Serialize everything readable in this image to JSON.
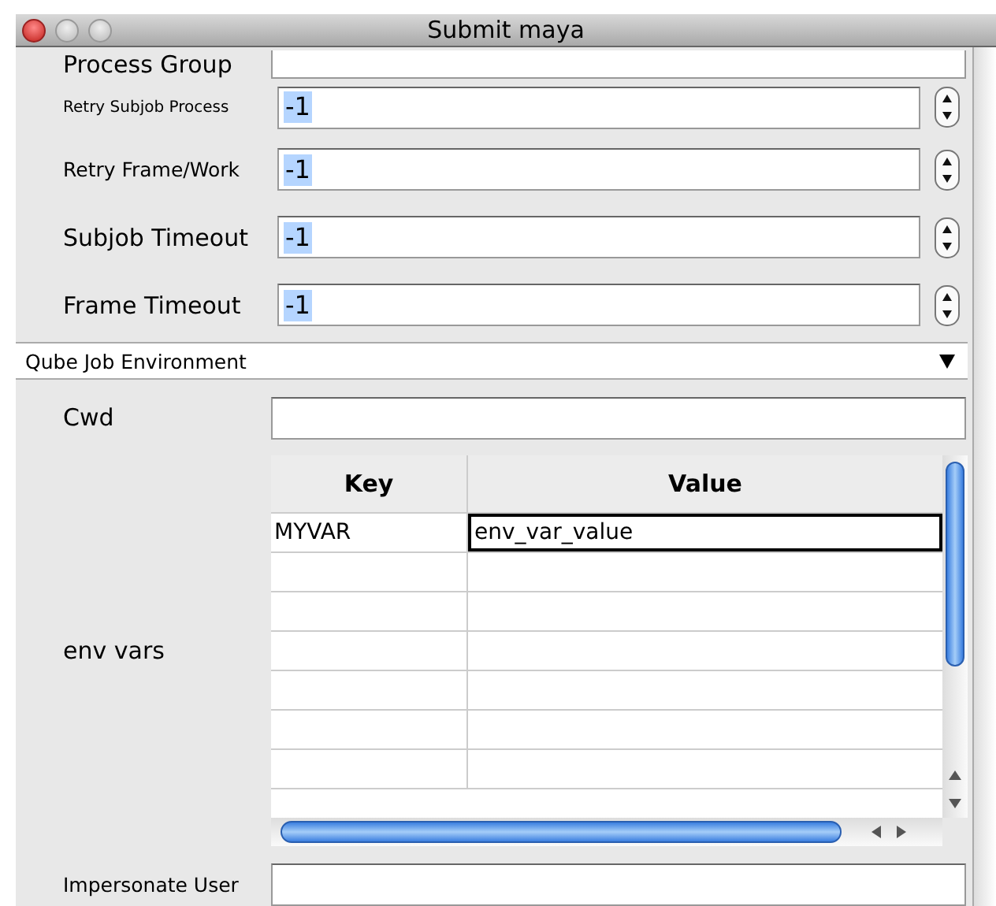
{
  "window": {
    "title": "Submit maya"
  },
  "top_fields": [
    {
      "label": "Process Group",
      "kind": "text"
    },
    {
      "label": "Retry Subjob Process",
      "kind": "spinner",
      "value": "-1",
      "value_selected": true
    },
    {
      "label": "Retry Frame/Work",
      "kind": "spinner",
      "value": "-1",
      "value_selected": true
    },
    {
      "label": "Subjob Timeout",
      "kind": "spinner",
      "value": "-1",
      "value_selected": true
    },
    {
      "label": "Frame Timeout",
      "kind": "spinner",
      "value": "-1",
      "value_selected": true
    }
  ],
  "section": {
    "title": "Qube Job Environment",
    "expanded": true
  },
  "cwd": {
    "label": "Cwd"
  },
  "env_vars": {
    "label": "env vars",
    "columns": [
      "Key",
      "Value"
    ],
    "rows": [
      {
        "key": "MYVAR",
        "value": "env_var_value",
        "editing": true
      }
    ]
  },
  "impersonate": {
    "label": "Impersonate User"
  }
}
